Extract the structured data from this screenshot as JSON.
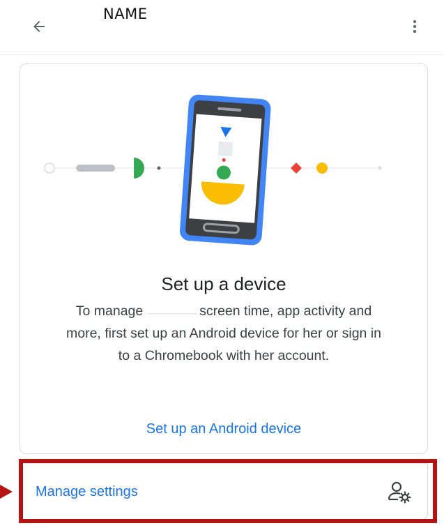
{
  "header": {
    "title": "NAME",
    "back_icon": "arrow-back-icon",
    "more_icon": "more-vert-icon"
  },
  "card": {
    "title": "Set up a device",
    "body_before": "To manage",
    "body_after": "screen time, app activity and more, first set up an Android device for her or sign in to a Chromebook with her account.",
    "link": "Set up an Android device",
    "illustration_icon": "phone-setup-illustration"
  },
  "manage": {
    "label": "Manage settings",
    "icon": "manage-accounts-icon"
  },
  "colors": {
    "accent_blue": "#1a73e8",
    "phone_blue": "#4285f4",
    "google_green": "#34a853",
    "google_yellow": "#fbbc04",
    "google_red": "#ea4335",
    "highlight": "#b51414"
  }
}
